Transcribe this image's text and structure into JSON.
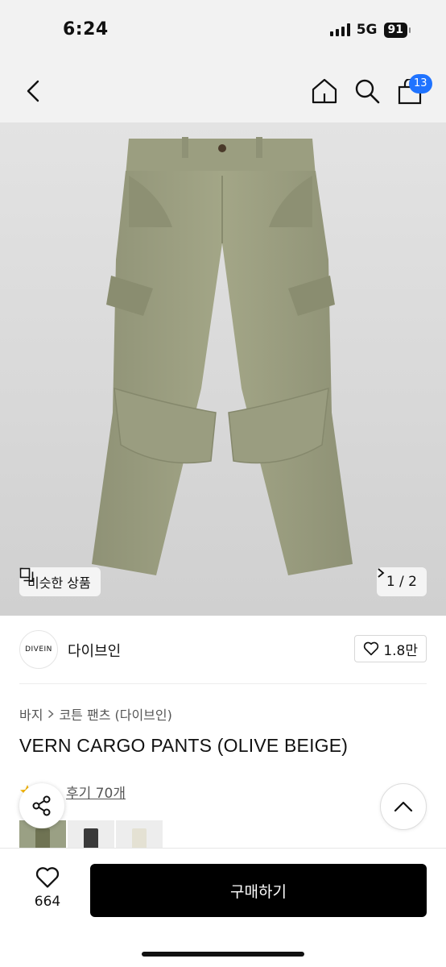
{
  "status_bar": {
    "time": "6:24",
    "network": "5G",
    "battery": "91"
  },
  "nav": {
    "cart_count": "13",
    "icons": [
      "chevron-left-icon",
      "home-icon",
      "search-icon",
      "shopping-bag-icon"
    ]
  },
  "hero": {
    "similar_label": "비슷한 상품",
    "page_indicator": "1 / 2"
  },
  "brand": {
    "logo_text": "DIVEIN",
    "name": "다이브인",
    "likes": "1.8만"
  },
  "breadcrumb": {
    "category": "바지",
    "subcategory": "코튼 팬츠 (다이브인)"
  },
  "product": {
    "title": "VERN CARGO PANTS (OLIVE BEIGE)",
    "review_text": "후기 70개"
  },
  "colors": {
    "options": [
      "#8b8e74",
      "#3a3a3a",
      "#e8e6dc"
    ]
  },
  "bottom": {
    "like_count": "664",
    "buy_label": "구매하기"
  },
  "theme": {
    "accent": "#1f73ff",
    "button": "#000000",
    "pants": "#9ea183"
  }
}
